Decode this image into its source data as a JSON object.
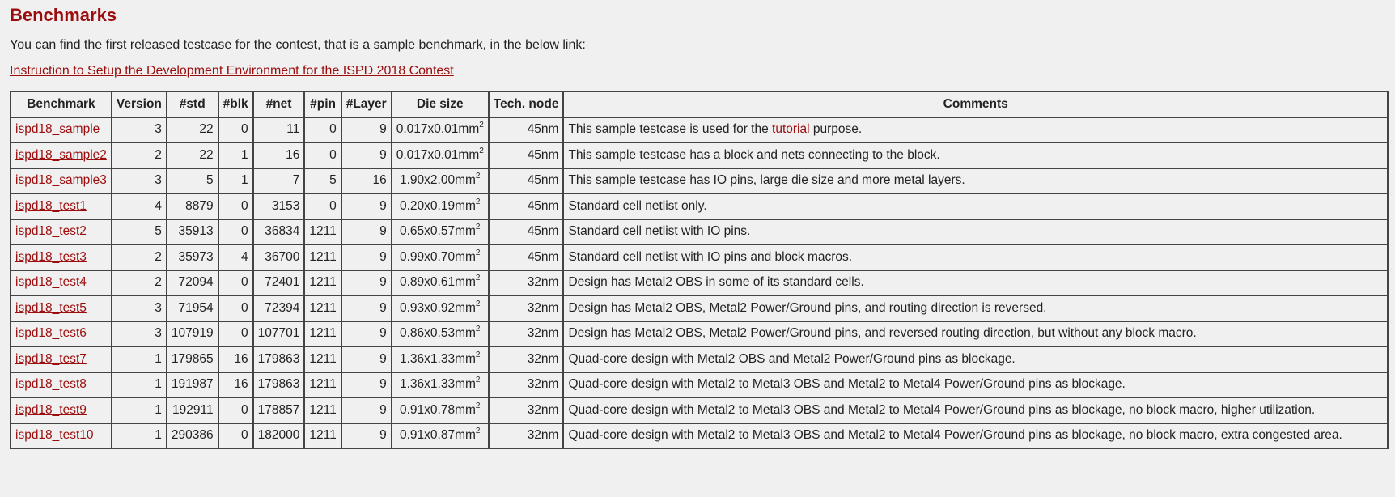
{
  "heading": "Benchmarks",
  "intro": "You can find the first released testcase for the contest, that is a sample benchmark, in the below link:",
  "setup_link": "Instruction to Setup the Development Environment for the ISPD 2018 Contest",
  "columns": [
    "Benchmark",
    "Version",
    "#std",
    "#blk",
    "#net",
    "#pin",
    "#Layer",
    "Die size",
    "Tech. node",
    "Comments"
  ],
  "rows": [
    {
      "name": "ispd18_sample",
      "version": "3",
      "std": "22",
      "blk": "0",
      "net": "11",
      "pin": "0",
      "layer": "9",
      "die": "0.017x0.01mm",
      "tech": "45nm",
      "comment_pre": "This sample testcase is used for the ",
      "comment_link": "tutorial",
      "comment_post": " purpose."
    },
    {
      "name": "ispd18_sample2",
      "version": "2",
      "std": "22",
      "blk": "1",
      "net": "16",
      "pin": "0",
      "layer": "9",
      "die": "0.017x0.01mm",
      "tech": "45nm",
      "comment": "This sample testcase has a block and nets connecting to the block."
    },
    {
      "name": "ispd18_sample3",
      "version": "3",
      "std": "5",
      "blk": "1",
      "net": "7",
      "pin": "5",
      "layer": "16",
      "die": "1.90x2.00mm",
      "tech": "45nm",
      "comment": "This sample testcase has IO pins, large die size and more metal layers."
    },
    {
      "name": "ispd18_test1",
      "version": "4",
      "std": "8879",
      "blk": "0",
      "net": "3153",
      "pin": "0",
      "layer": "9",
      "die": "0.20x0.19mm",
      "tech": "45nm",
      "comment": "Standard cell netlist only."
    },
    {
      "name": "ispd18_test2",
      "version": "5",
      "std": "35913",
      "blk": "0",
      "net": "36834",
      "pin": "1211",
      "layer": "9",
      "die": "0.65x0.57mm",
      "tech": "45nm",
      "comment": "Standard cell netlist with IO pins."
    },
    {
      "name": "ispd18_test3",
      "version": "2",
      "std": "35973",
      "blk": "4",
      "net": "36700",
      "pin": "1211",
      "layer": "9",
      "die": "0.99x0.70mm",
      "tech": "45nm",
      "comment": "Standard cell netlist with IO pins and block macros."
    },
    {
      "name": "ispd18_test4",
      "version": "2",
      "std": "72094",
      "blk": "0",
      "net": "72401",
      "pin": "1211",
      "layer": "9",
      "die": "0.89x0.61mm",
      "tech": "32nm",
      "comment": "Design has Metal2 OBS in some of its standard cells."
    },
    {
      "name": "ispd18_test5",
      "version": "3",
      "std": "71954",
      "blk": "0",
      "net": "72394",
      "pin": "1211",
      "layer": "9",
      "die": "0.93x0.92mm",
      "tech": "32nm",
      "comment": "Design has Metal2 OBS, Metal2 Power/Ground pins, and routing direction is reversed."
    },
    {
      "name": "ispd18_test6",
      "version": "3",
      "std": "107919",
      "blk": "0",
      "net": "107701",
      "pin": "1211",
      "layer": "9",
      "die": "0.86x0.53mm",
      "tech": "32nm",
      "comment": "Design has Metal2 OBS, Metal2 Power/Ground pins, and reversed routing direction, but without any block macro."
    },
    {
      "name": "ispd18_test7",
      "version": "1",
      "std": "179865",
      "blk": "16",
      "net": "179863",
      "pin": "1211",
      "layer": "9",
      "die": "1.36x1.33mm",
      "tech": "32nm",
      "comment": "Quad-core design with Metal2 OBS and Metal2 Power/Ground pins as blockage."
    },
    {
      "name": "ispd18_test8",
      "version": "1",
      "std": "191987",
      "blk": "16",
      "net": "179863",
      "pin": "1211",
      "layer": "9",
      "die": "1.36x1.33mm",
      "tech": "32nm",
      "comment": "Quad-core design with Metal2 to Metal3 OBS and Metal2 to Metal4 Power/Ground pins as blockage."
    },
    {
      "name": "ispd18_test9",
      "version": "1",
      "std": "192911",
      "blk": "0",
      "net": "178857",
      "pin": "1211",
      "layer": "9",
      "die": "0.91x0.78mm",
      "tech": "32nm",
      "comment": "Quad-core design with Metal2 to Metal3 OBS and Metal2 to Metal4 Power/Ground pins as blockage, no block macro, higher utilization."
    },
    {
      "name": "ispd18_test10",
      "version": "1",
      "std": "290386",
      "blk": "0",
      "net": "182000",
      "pin": "1211",
      "layer": "9",
      "die": "0.91x0.87mm",
      "tech": "32nm",
      "comment": "Quad-core design with Metal2 to Metal3 OBS and Metal2 to Metal4 Power/Ground pins as blockage, no block macro, extra congested area."
    }
  ],
  "die_unit_sup": "2",
  "colors": {
    "heading": "#9b0d0d",
    "link": "#9b0d0d",
    "background": "#f0f0f0",
    "border": "#444444"
  }
}
